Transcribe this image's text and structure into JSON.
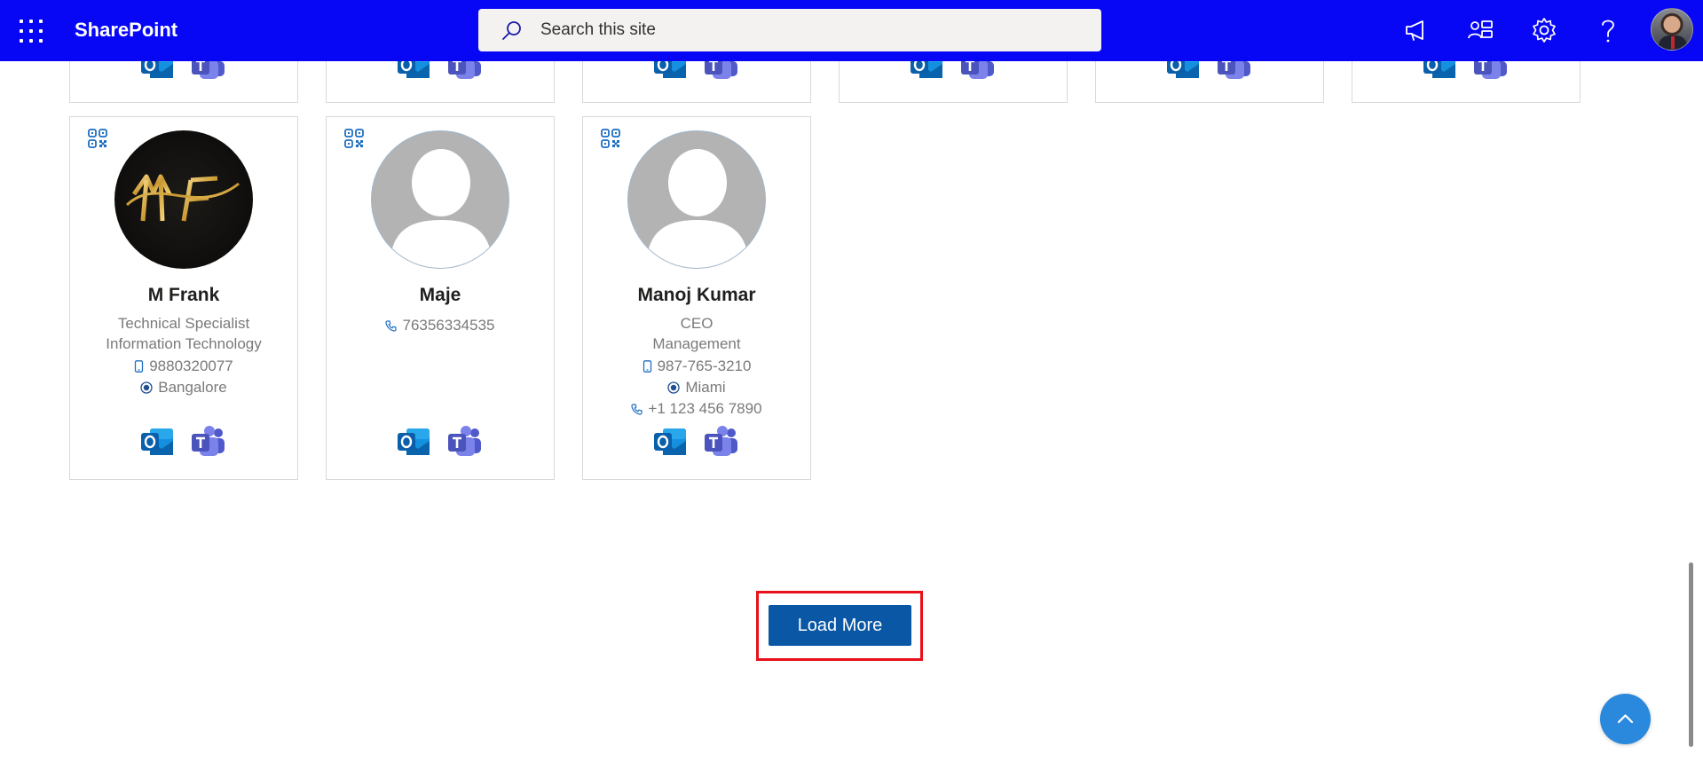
{
  "suitebar": {
    "app_name": "SharePoint",
    "search_placeholder": "Search this site",
    "icons": [
      "app-launcher-icon",
      "announcement-icon",
      "share-icon",
      "settings-icon",
      "help-icon"
    ]
  },
  "profiles": [
    {
      "name": "M Frank",
      "title": "Technical Specialist",
      "department": "Information Technology",
      "mobile": "9880320077",
      "location": "Bangalore",
      "photo": "MF logo"
    },
    {
      "name": "Maje",
      "phone": "76356334535",
      "photo": "placeholder"
    },
    {
      "name": "Manoj Kumar",
      "title": "CEO",
      "department": "Management",
      "mobile": "987-765-3210",
      "location": "Miami",
      "phone": "+1 123 456 7890",
      "photo": "placeholder"
    }
  ],
  "actions": {
    "load_more": "Load More"
  },
  "colors": {
    "suitebar": "#0707f5",
    "accent": "#0a58a5",
    "highlight": "#e8101a",
    "back_to_top": "#2b89dd"
  }
}
